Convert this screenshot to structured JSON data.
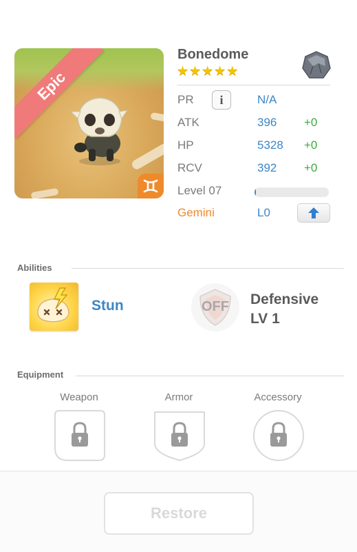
{
  "monster": {
    "name": "Bonedome",
    "rarity": "Epic",
    "stars": 5,
    "element_icon": "earth-rock-icon",
    "zodiac_icon": "gemini-icon"
  },
  "stats": {
    "pr_label": "PR",
    "pr_value": "N/A",
    "info_label": "i",
    "atk_label": "ATK",
    "atk_value": "396",
    "atk_bonus": "+0",
    "hp_label": "HP",
    "hp_value": "5328",
    "hp_bonus": "+0",
    "rcv_label": "RCV",
    "rcv_value": "392",
    "rcv_bonus": "+0",
    "level_label": "Level 07",
    "level_progress": 0.02,
    "zodiac_label": "Gemini",
    "zodiac_value": "L0"
  },
  "abilities": {
    "section_title": "Abilities",
    "active_name": "Stun",
    "passive_toggle": "OFF",
    "passive_name": "Defensive",
    "passive_level": "LV 1"
  },
  "equipment": {
    "section_title": "Equipment",
    "slots": [
      {
        "label": "Weapon"
      },
      {
        "label": "Armor"
      },
      {
        "label": "Accessory"
      }
    ]
  },
  "footer": {
    "restore_label": "Restore"
  },
  "colors": {
    "rarity_ribbon": "#f07a7a",
    "stat_value": "#3b86c6",
    "stat_bonus": "#3daa3d",
    "zodiac": "#ee8a2c",
    "star": "#f5c400"
  }
}
